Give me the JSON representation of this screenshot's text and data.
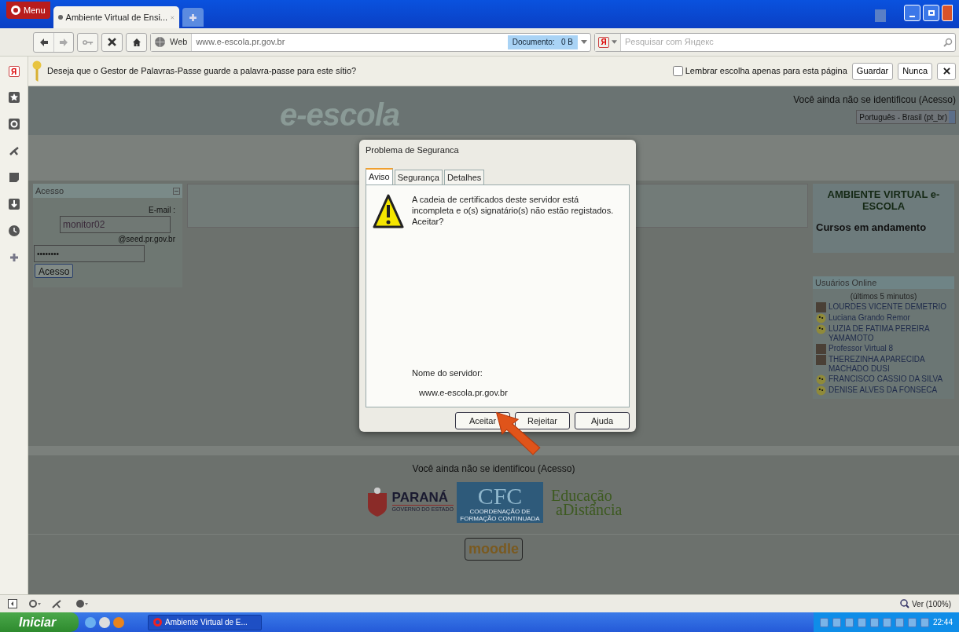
{
  "browser": {
    "menu_label": "Menu",
    "tabs": [
      {
        "title": "Ambiente Virtual de Ensi...",
        "selected": true
      }
    ],
    "address_scope": "Web",
    "url": "www.e-escola.pr.gov.br",
    "document_size": "Documento:   0 B",
    "search_placeholder": "Pesquisar com Яндекс",
    "search_engine_letter": "Я"
  },
  "sidebar": {
    "logo_letter": "Я",
    "items": [
      {
        "kind": "bookmark"
      },
      {
        "kind": "widget"
      },
      {
        "kind": "unite"
      },
      {
        "kind": "note"
      },
      {
        "kind": "download"
      },
      {
        "kind": "history"
      },
      {
        "kind": "add"
      }
    ]
  },
  "password_bar": {
    "prompt": "Deseja que o Gestor de Palavras-Passe guarde a palavra-passe para este sítio?",
    "remember": {
      "label": "Lembrar escolha apenas para esta página",
      "checked": false
    },
    "buttons": [
      "Guardar",
      "Nunca"
    ]
  },
  "page": {
    "logo": "e-escola",
    "login_status": "Você ainda não se identificou (Acesso)",
    "language": "Português - Brasil (pt_br)",
    "login_block": {
      "title": "Acesso",
      "email_label": "E-mail :",
      "username": "monitor02",
      "domain": "@seed.pr.gov.br",
      "password": "••••••••",
      "button": "Acesso"
    },
    "info_block": {
      "title": "AMBIENTE VIRTUAL e-ESCOLA",
      "subtitle": "Cursos em andamento"
    },
    "online_block": {
      "title": "Usuários Online",
      "note": "(últimos 5 minutos)",
      "users": [
        {
          "name": "LOURDES VICENTE DEMETRIO",
          "kind": "photo"
        },
        {
          "name": "Luciana Grando Remor",
          "kind": "smiley"
        },
        {
          "name": "LUZIA DE FATIMA PEREIRA YAMAMOTO",
          "kind": "smiley"
        },
        {
          "name": "Professor Virtual 8",
          "kind": "photo"
        },
        {
          "name": "THEREZINHA APARECIDA MACHADO DUSI",
          "kind": "photo"
        },
        {
          "name": "FRANCISCO CASSIO DA SILVA",
          "kind": "smiley"
        },
        {
          "name": "DENISE ALVES DA FONSECA",
          "kind": "smiley"
        }
      ]
    },
    "footer": {
      "login_status": "Você ainda não se identificou (Acesso)",
      "parana": "PARANÁ",
      "parana_sub": "GOVERNO DO ESTADO",
      "cfc": "CFC",
      "cfc_sub": "COORDENAÇÃO DE FORMAÇÃO CONTINUADA",
      "ead_top": "Educação",
      "ead_bottom": "aDistância",
      "moodle": "moodle"
    }
  },
  "dialog": {
    "title": "Problema de Seguranca",
    "tabs": [
      {
        "label": "Aviso",
        "selected": true
      },
      {
        "label": "Segurança",
        "selected": false
      },
      {
        "label": "Detalhes",
        "selected": false
      }
    ],
    "message": "A cadeia de certificados deste servidor está incompleta e o(s) signatário(s) não estão registados. Aceitar?",
    "server_label": "Nome do servidor:",
    "server": "www.e-escola.pr.gov.br",
    "buttons": [
      "Aceitar",
      "Rejeitar",
      "Ajuda"
    ]
  },
  "status_bar": {
    "zoom": "Ver (100%)"
  },
  "taskbar": {
    "start": "Iniciar",
    "window": "Ambiente Virtual de E...",
    "time": "22:44"
  }
}
